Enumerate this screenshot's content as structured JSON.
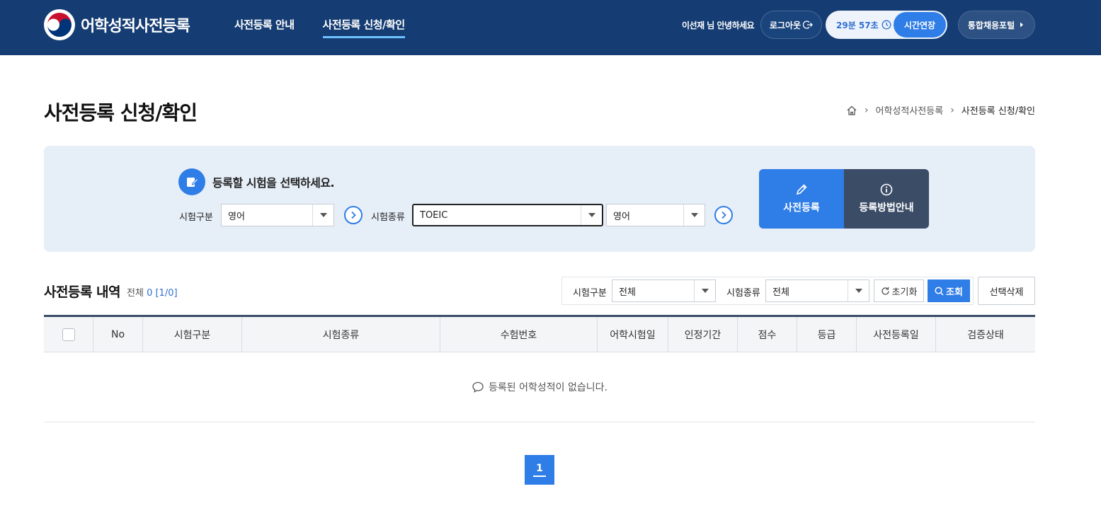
{
  "header": {
    "logo_text": "어학성적사전등록",
    "nav": [
      "사전등록 안내",
      "사전등록 신청/확인"
    ],
    "greeting": "이선재 님 안녕하세요",
    "logout_label": "로그아웃",
    "timer": "29분 57초",
    "extend_label": "시간연장",
    "portal_label": "통합채용포털"
  },
  "page": {
    "title": "사전등록 신청/확인",
    "breadcrumb": [
      "어학성적사전등록",
      "사전등록 신청/확인"
    ]
  },
  "select_box": {
    "title": "등록할 시험을 선택하세요.",
    "exam_type_label": "시험구분",
    "exam_type_value": "영어",
    "exam_kind_label": "시험종류",
    "exam_kind_value": "TOEIC",
    "exam_lang_value": "영어",
    "register_label": "사전등록",
    "guide_label": "등록방법안내"
  },
  "history": {
    "title": "사전등록 내역",
    "count_prefix": "전체",
    "count_num": "0",
    "count_page": "[1/0]",
    "filter": {
      "type_label": "시험구분",
      "type_value": "전체",
      "kind_label": "시험종류",
      "kind_value": "전체",
      "reset_label": "초기화",
      "search_label": "조회"
    },
    "delete_label": "선택삭제"
  },
  "table": {
    "columns": [
      "No",
      "시험구분",
      "시험종류",
      "수험번호",
      "어학시험일",
      "인정기간",
      "점수",
      "등급",
      "사전등록일",
      "검증상태"
    ],
    "empty_message": "등록된 어학성적이 없습니다."
  },
  "pagination": {
    "current": "1"
  },
  "colors": {
    "header_bg": "#153d73",
    "accent": "#2f7de6",
    "dark_button": "#3b4c67",
    "panel_bg": "#e6eef8"
  }
}
